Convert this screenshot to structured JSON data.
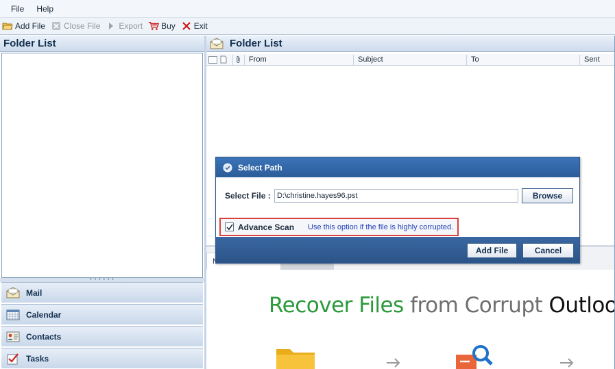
{
  "menu": {
    "file": "File",
    "help": "Help"
  },
  "toolbar": {
    "add_file": "Add File",
    "close_file": "Close File",
    "export": "Export",
    "buy": "Buy",
    "exit": "Exit"
  },
  "left_panel": {
    "title": "Folder List",
    "nav": [
      {
        "label": "Mail",
        "icon": "mail-icon"
      },
      {
        "label": "Calendar",
        "icon": "calendar-icon"
      },
      {
        "label": "Contacts",
        "icon": "contacts-icon"
      },
      {
        "label": "Tasks",
        "icon": "tasks-icon"
      }
    ]
  },
  "right_panel": {
    "title": "Folder List",
    "columns": [
      "From",
      "Subject",
      "To",
      "Sent"
    ],
    "preview_tab": "N",
    "banner": {
      "part1": "Recover Files",
      "part2": " from Corrupt ",
      "part3": "Outlook"
    }
  },
  "dialog": {
    "title": "Select Path",
    "select_file_label": "Select File :",
    "path_value": "D:\\christine.hayes96.pst",
    "browse_label": "Browse",
    "advance_scan_label": "Advance Scan",
    "advance_scan_checked": true,
    "advance_scan_hint": "Use this option if the file is highly corrupted.",
    "add_file_label": "Add File",
    "cancel_label": "Cancel"
  },
  "colors": {
    "accent_blue": "#2c5c99",
    "highlight_red": "#d9423c",
    "banner_green": "#2c9a3c"
  }
}
